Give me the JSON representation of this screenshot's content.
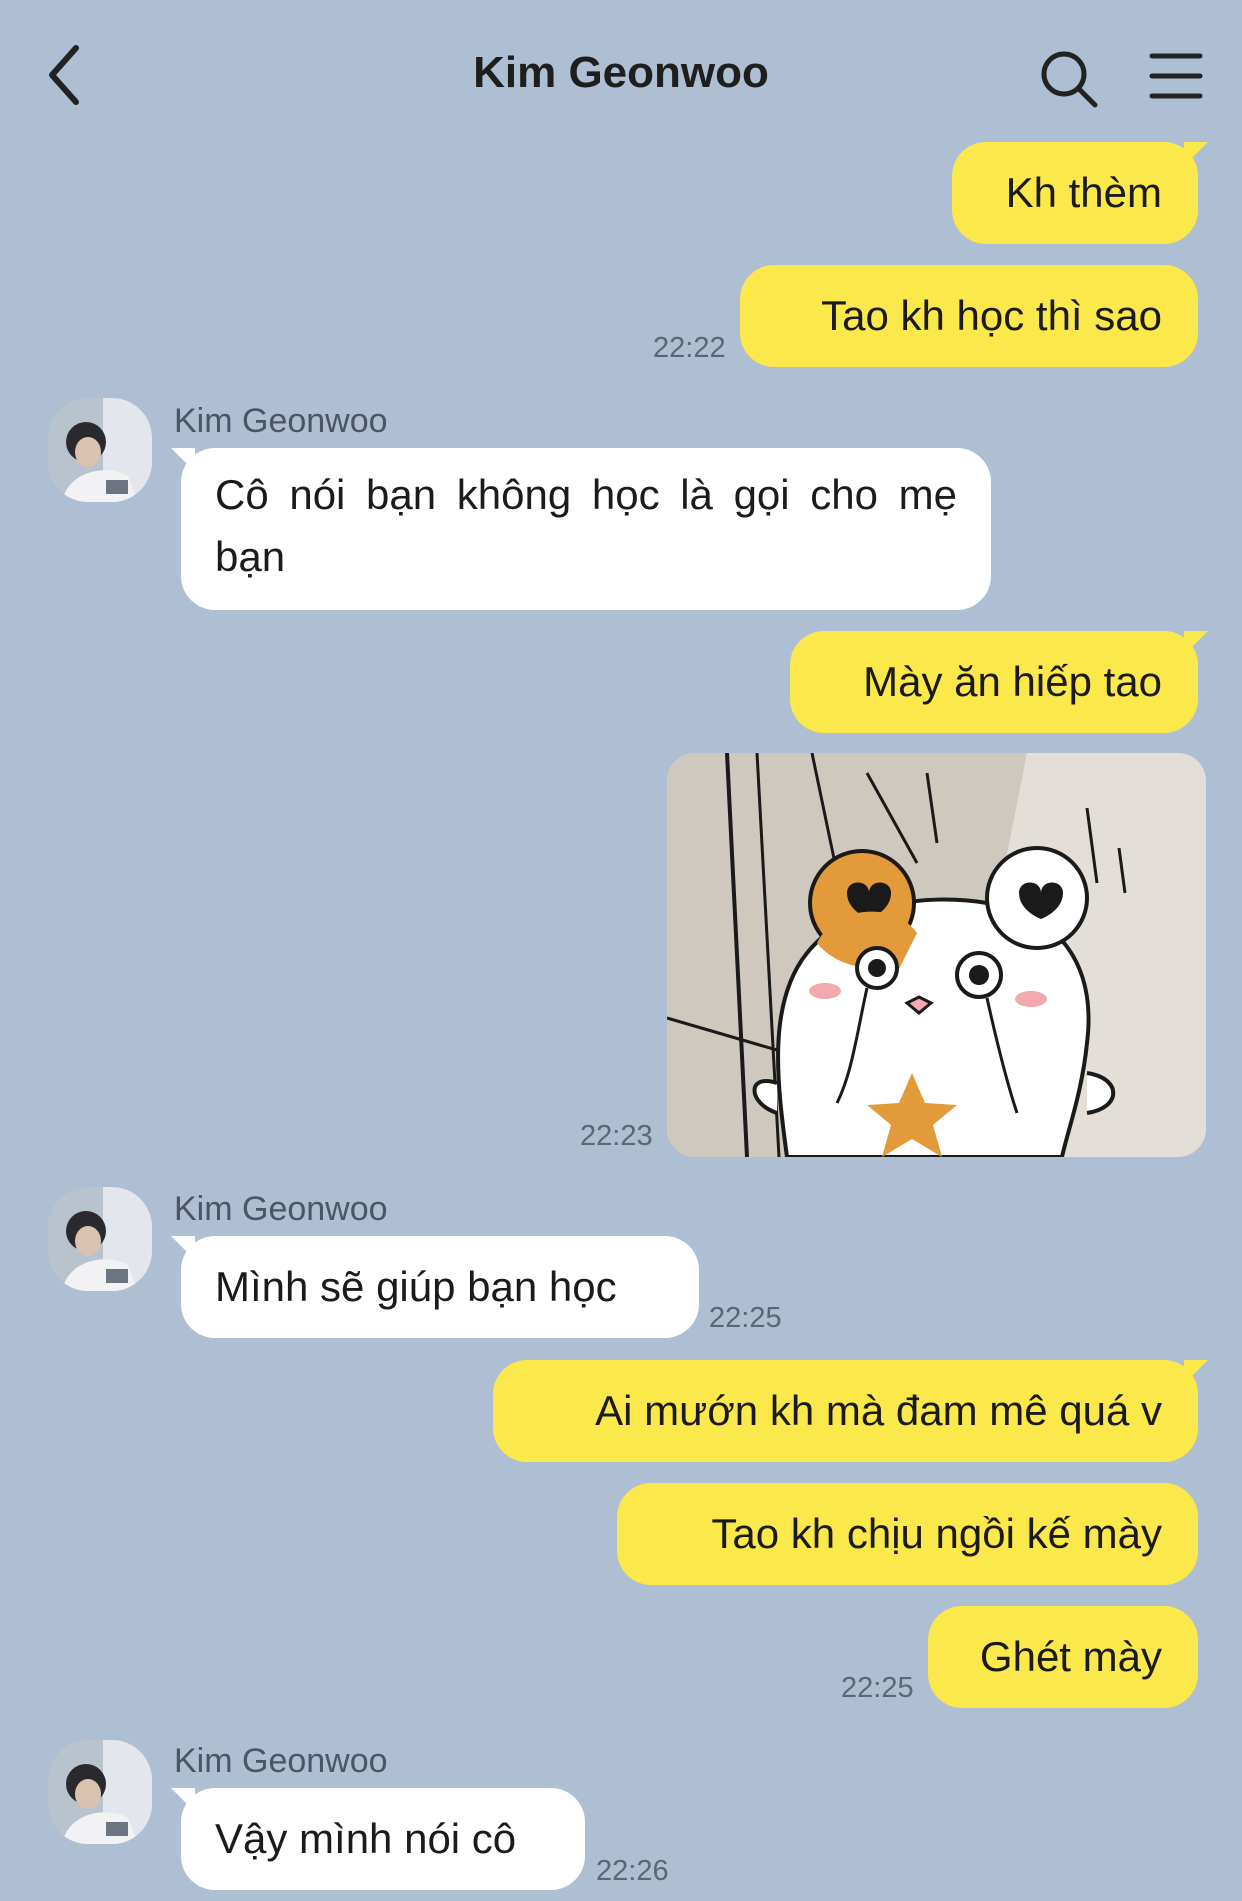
{
  "header": {
    "title": "Kim Geonwoo"
  },
  "messages": {
    "m1": "Kh thèm",
    "m2": "Tao kh học thì sao",
    "t1": "22:22",
    "s1": "Kim Geonwoo",
    "m3": "Cô nói bạn không học là gọi cho mẹ bạn",
    "m4": "Mày ăn hiếp tao",
    "t2": "22:23",
    "s2": "Kim Geonwoo",
    "m5": "Mình sẽ giúp bạn học",
    "t3": "22:25",
    "m6": "Ai mướn kh mà đam mê quá v",
    "m7": "Tao kh chịu ngồi kế mày",
    "m8": "Ghét mày",
    "t4": "22:25",
    "s3": "Kim Geonwoo",
    "m9": "Vậy mình nói cô",
    "t5": "22:26"
  },
  "icons": [
    "back-arrow-icon",
    "search-icon",
    "menu-icon",
    "hamster-sticker"
  ],
  "colors": {
    "background": "#aebfd3",
    "outgoing": "#fbe84a",
    "incoming": "#ffffff"
  }
}
